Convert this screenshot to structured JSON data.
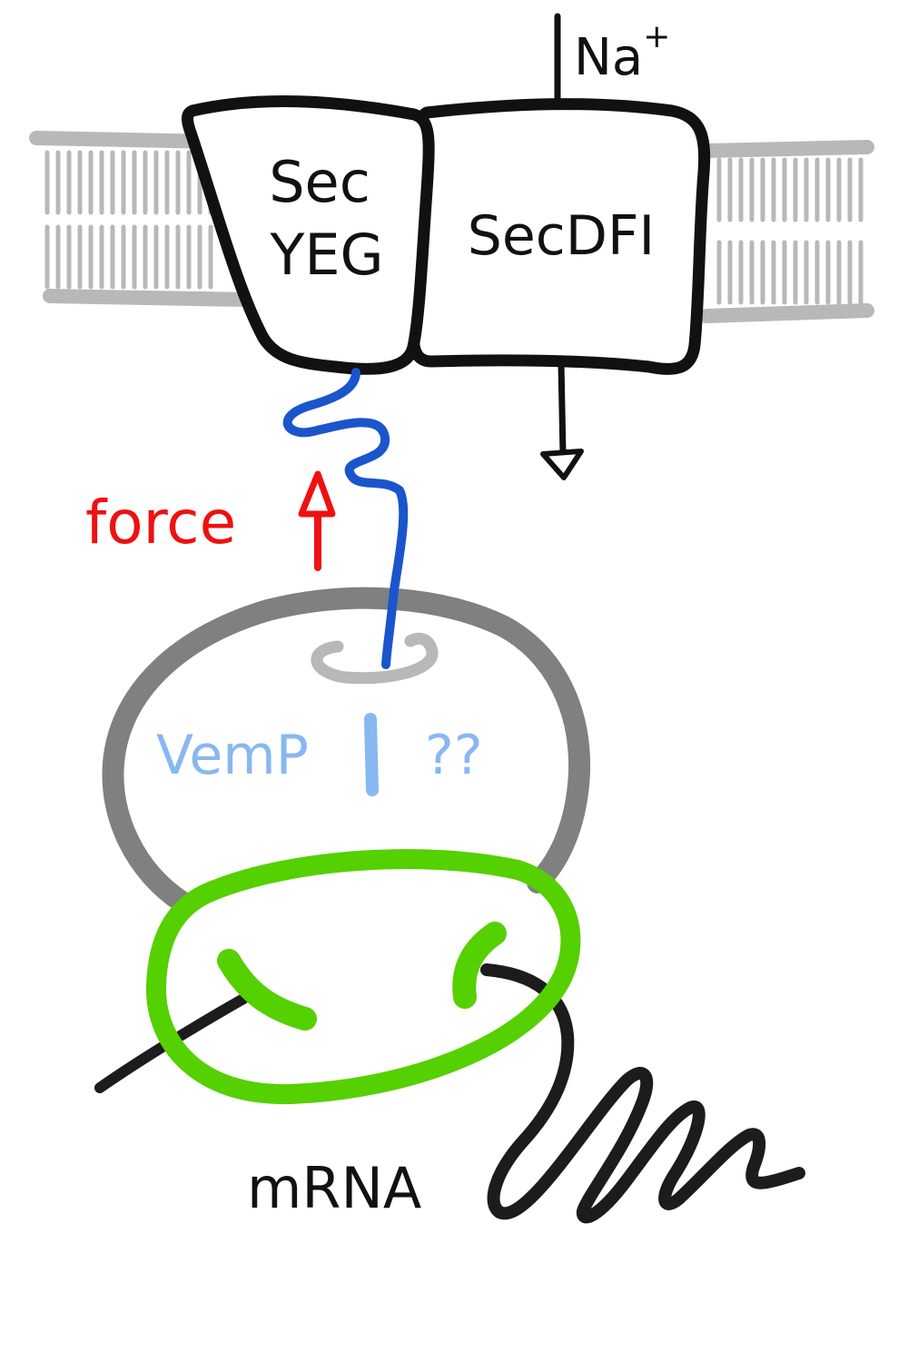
{
  "labels": {
    "ion": "Na",
    "ion_charge": "+",
    "secyeg_line1": "Sec",
    "secyeg_line2": "YEG",
    "secdfi": "SecDFI",
    "force": "force",
    "vemp": "VemP",
    "unknown": "??",
    "mrna": "mRNA"
  },
  "colors": {
    "membrane": "#b8b8b8",
    "protein_outline": "#111111",
    "nascent_chain": "#1a55cc",
    "force_arrow": "#ee1111",
    "vemp": "#88b8f0",
    "ribosome_large": "#808080",
    "ribosome_small": "#55d000",
    "mrna": "#1c1c1c"
  }
}
